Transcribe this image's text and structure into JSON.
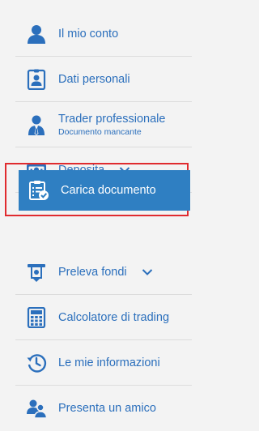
{
  "menu": {
    "items": [
      {
        "label": "Il mio conto",
        "icon": "user-icon"
      },
      {
        "label": "Dati personali",
        "icon": "id-badge-icon"
      },
      {
        "label": "Trader professionale",
        "sublabel": "Documento mancante",
        "icon": "businessman-icon"
      },
      {
        "label": "Deposita",
        "icon": "banknote-icon",
        "expandable": true
      },
      {
        "label": "Carica documento",
        "icon": "clipboard-check-icon",
        "active": true
      },
      {
        "label": "Preleva fondi",
        "icon": "withdraw-cash-icon",
        "expandable": true
      },
      {
        "label": "Calcolatore di trading",
        "icon": "calculator-icon"
      },
      {
        "label": "Le mie informazioni",
        "icon": "history-clock-icon"
      },
      {
        "label": "Presenta un amico",
        "icon": "refer-friends-icon"
      }
    ]
  },
  "colors": {
    "link_blue": "#2b6fbc",
    "active_bg": "#2f7fc2",
    "highlight_border": "#e02b2f",
    "background": "#f3f3f3",
    "divider": "#dcdcdc"
  }
}
